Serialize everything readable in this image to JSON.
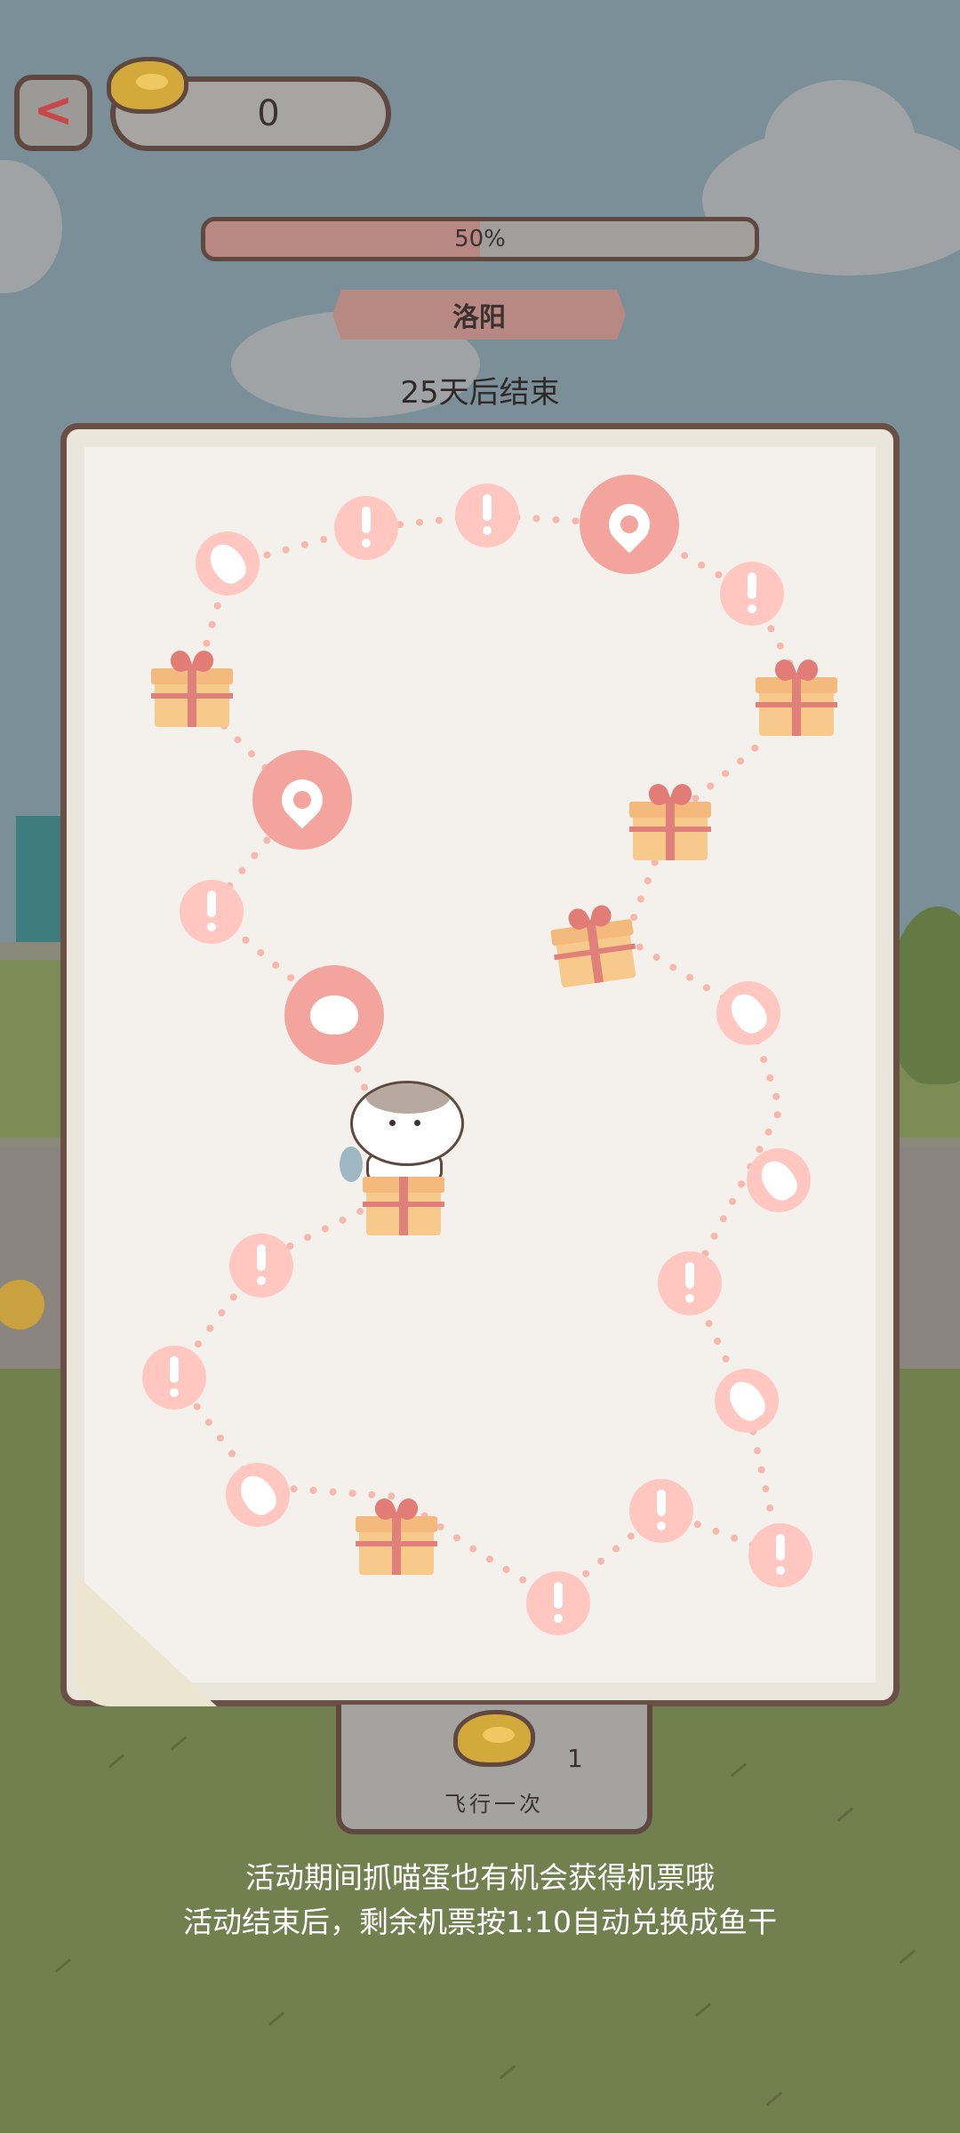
{
  "top_bar": {
    "back_icon": "chevron-left-icon",
    "ticket_icon": "plane-ticket-icon",
    "ticket_count": "0"
  },
  "progress": {
    "percent": 50,
    "label": "50%"
  },
  "city": "洛阳",
  "countdown": "25天后结束",
  "map": {
    "node_types": [
      "exclamation-icon",
      "fish-icon",
      "location-pin-icon",
      "heart-icon",
      "gift-icon"
    ],
    "colors": {
      "node_light": "#ffc7c0",
      "node_dark": "#f3a49c",
      "gift": "#f7c98b",
      "ribbon": "#e0807a",
      "path_dot": "#f6b7ad"
    }
  },
  "fly_button": {
    "label": "飞行一次",
    "cost": "1",
    "ticket_icon": "plane-ticket-icon"
  },
  "notes": {
    "line1": "活动期间抓喵蛋也有机会获得机票哦",
    "line2": "活动结束后，剩余机票按1:10自动兑换成鱼干"
  },
  "colors": {
    "accent_red": "#c9464a",
    "frame_brown": "#5e4840",
    "progress_fill": "#b98882"
  }
}
